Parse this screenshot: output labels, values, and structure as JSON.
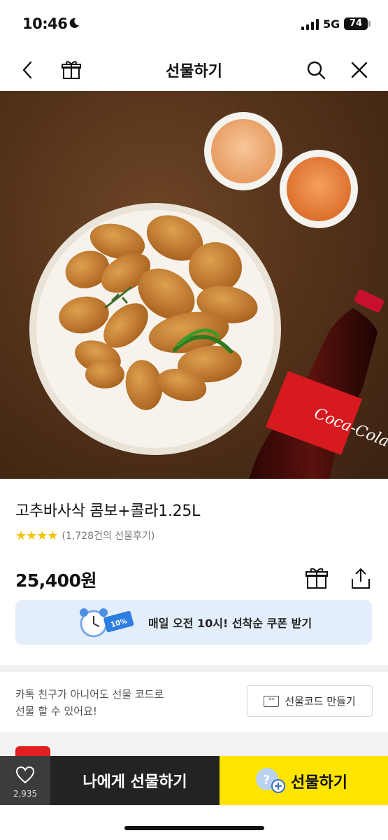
{
  "status_bar": {
    "time": "10:46",
    "network": "5G",
    "battery": "74"
  },
  "nav": {
    "title": "선물하기",
    "back_icon": "back-chevron-icon",
    "gift_icon": "gift-box-icon",
    "search_icon": "search-icon",
    "close_icon": "close-icon"
  },
  "product": {
    "name": "고추바사삭 콤보+콜라1.25L",
    "stars": "★★★★",
    "rating_value": 4,
    "review_text": "(1,728건의 선물후기)",
    "price": "25,400원",
    "image_bottle_label": "Coca-Cola"
  },
  "coupon": {
    "text": "매일 오전 10시! 선착순 쿠폰 받기",
    "badge": "10%"
  },
  "gift_code": {
    "line1": "카톡 친구가 아니어도 선물 코드로",
    "line2": "선물 할 수 있어요!",
    "button_label": "선물코드 만들기",
    "button_icon_text": "**"
  },
  "bottom_bar": {
    "like_count": "2,935",
    "self_gift_label": "나에게 선물하기",
    "gift_label": "선물하기"
  },
  "colors": {
    "accent_yellow": "#fde500",
    "star": "#f5c400",
    "coupon_bg": "#e4eefb",
    "dark_button": "#232323"
  }
}
